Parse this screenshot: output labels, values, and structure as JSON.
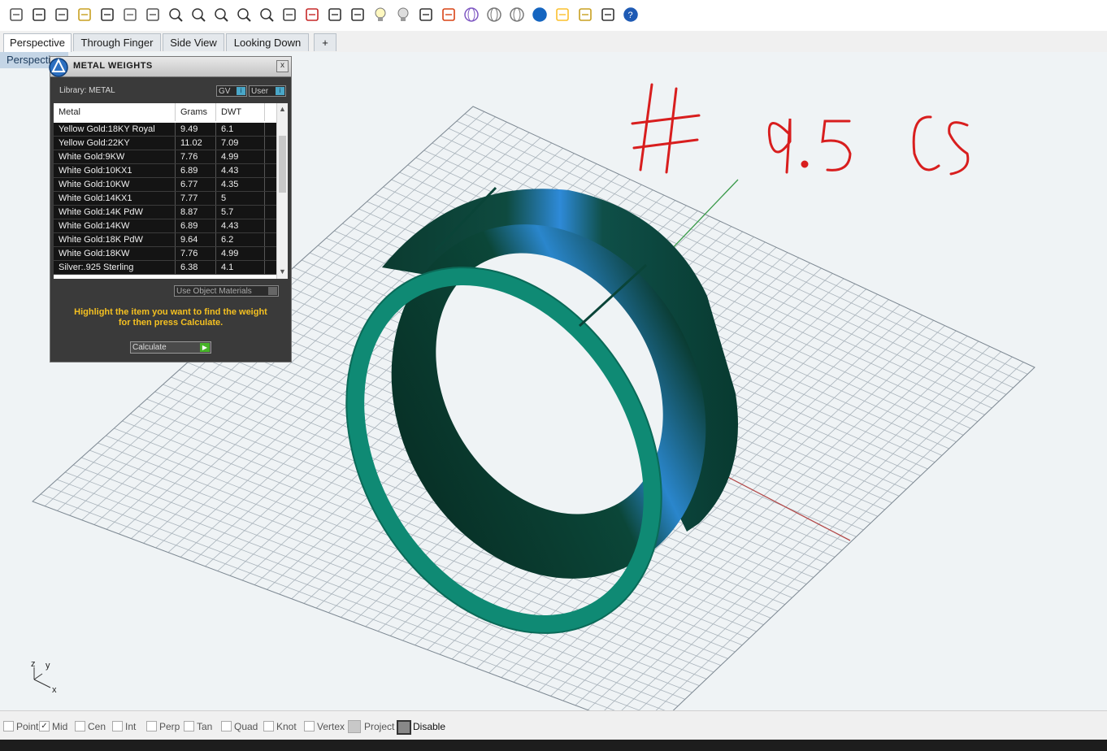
{
  "toolbar": {
    "icons": [
      "new-file-icon",
      "cut-icon",
      "copy-icon",
      "paste-icon",
      "undo-icon",
      "pan-hand-icon",
      "rotate-view-icon",
      "zoom-icon",
      "zoom-window-icon",
      "zoom-extents-icon",
      "zoom-selected-icon",
      "zoom-previous-icon",
      "four-viewports-icon",
      "car-icon",
      "object-properties-icon",
      "point-on-icon",
      "lightbulb-icon",
      "lightbulb-off-icon",
      "lock-icon",
      "layer-icon",
      "color-wheel-icon",
      "sphere-wire-icon",
      "sphere-grid-icon",
      "sphere-render-icon",
      "render-icon",
      "gear-icon",
      "grip-icon",
      "help-icon"
    ]
  },
  "tabs": [
    "Perspective",
    "Through Finger",
    "Side View",
    "Looking Down",
    "+"
  ],
  "viewport": {
    "label": "Perspective",
    "annotation": "# 9.5 US",
    "axis_labels": {
      "z": "z",
      "y": "y",
      "x": "x"
    }
  },
  "panel": {
    "title": "METAL WEIGHTS",
    "close": "x",
    "library_label": "Library: METAL",
    "btn_gv": "GV",
    "btn_user": "User",
    "columns": [
      "Metal",
      "Grams",
      "DWT"
    ],
    "rows": [
      [
        "Yellow Gold:18KY Royal",
        "9.49",
        "6.1"
      ],
      [
        "Yellow Gold:22KY",
        "11.02",
        "7.09"
      ],
      [
        "White Gold:9KW",
        "7.76",
        "4.99"
      ],
      [
        "White Gold:10KX1",
        "6.89",
        "4.43"
      ],
      [
        "White Gold:10KW",
        "6.77",
        "4.35"
      ],
      [
        "White Gold:14KX1",
        "7.77",
        "5"
      ],
      [
        "White Gold:14K PdW",
        "8.87",
        "5.7"
      ],
      [
        "White Gold:14KW",
        "6.89",
        "4.43"
      ],
      [
        "White Gold:18K PdW",
        "9.64",
        "6.2"
      ],
      [
        "White Gold:18KW",
        "7.76",
        "4.99"
      ],
      [
        "Silver:.925 Sterling",
        "6.38",
        "4.1"
      ]
    ],
    "use_object_materials": "Use Object Materials",
    "hint_line1": "Highlight the item you want to find the weight",
    "hint_line2": "for then press Calculate.",
    "calculate": "Calculate"
  },
  "statusbar": {
    "snaps": [
      {
        "label": "Point",
        "checked": false
      },
      {
        "label": "Mid",
        "checked": true
      },
      {
        "label": "Cen",
        "checked": false
      },
      {
        "label": "Int",
        "checked": false
      },
      {
        "label": "Perp",
        "checked": false
      },
      {
        "label": "Tan",
        "checked": false
      },
      {
        "label": "Quad",
        "checked": false
      },
      {
        "label": "Knot",
        "checked": false
      },
      {
        "label": "Vertex",
        "checked": false
      },
      {
        "label": "Project",
        "checked": false
      },
      {
        "label": "Disable",
        "checked": false
      }
    ]
  },
  "colors": {
    "accent_yellow": "#f4c021",
    "ring_teal": "#0f8a74",
    "annotation_red": "#d81e1e",
    "grid_line": "#a9b3bb"
  }
}
